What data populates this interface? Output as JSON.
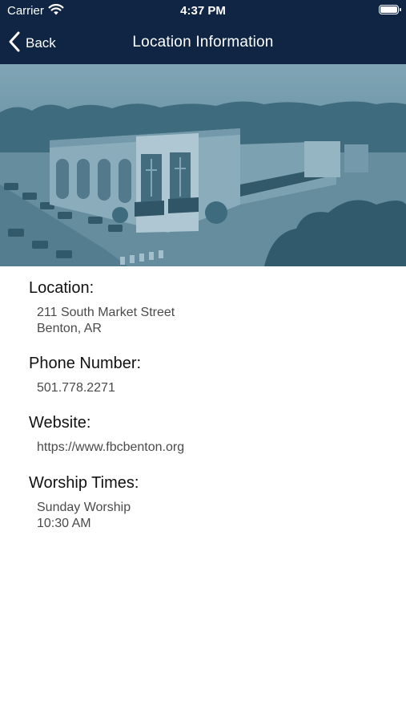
{
  "status_bar": {
    "carrier": "Carrier",
    "time": "4:37 PM",
    "wifi_icon": "wifi-icon",
    "battery_icon": "battery-icon"
  },
  "nav": {
    "back_label": "Back",
    "back_icon": "chevron-left-icon",
    "title": "Location Information"
  },
  "colors": {
    "nav_bg": "#0f2543",
    "hero_tint": "#5c8697",
    "heading_text": "#111111",
    "value_text": "#4a4a4a"
  },
  "hero_image": {
    "alt": "church-building-aerial-photo"
  },
  "info": {
    "location": {
      "heading": "Location:",
      "line1": "211 South Market Street",
      "line2": "Benton, AR"
    },
    "phone": {
      "heading": "Phone Number:",
      "value": "501.778.2271"
    },
    "website": {
      "heading": "Website:",
      "value": "https://www.fbcbenton.org"
    },
    "worship": {
      "heading": "Worship Times:",
      "line1": "Sunday Worship",
      "line2": "10:30 AM"
    }
  }
}
